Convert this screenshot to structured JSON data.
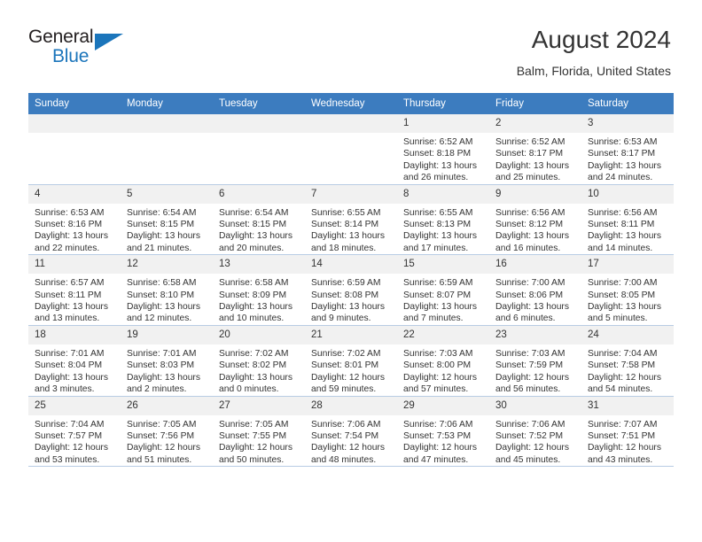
{
  "brand": {
    "general": "General",
    "blue": "Blue",
    "triangle_color": "#1b75bb"
  },
  "header": {
    "title": "August 2024",
    "location": "Balm, Florida, United States"
  },
  "theme": {
    "header_row_bg": "#3c7cbf",
    "daynum_bg": "#f1f1f1",
    "grid_border": "#b8cce4",
    "text": "#333333"
  },
  "weekday_headers": [
    "Sunday",
    "Monday",
    "Tuesday",
    "Wednesday",
    "Thursday",
    "Friday",
    "Saturday"
  ],
  "labels": {
    "sunrise_prefix": "Sunrise:",
    "sunset_prefix": "Sunset:",
    "daylight_prefix": "Daylight:"
  },
  "weeks": [
    [
      {
        "day": "",
        "empty": true
      },
      {
        "day": "",
        "empty": true
      },
      {
        "day": "",
        "empty": true
      },
      {
        "day": "",
        "empty": true
      },
      {
        "day": "1",
        "sunrise": "Sunrise: 6:52 AM",
        "sunset": "Sunset: 8:18 PM",
        "daylight": "Daylight: 13 hours and 26 minutes."
      },
      {
        "day": "2",
        "sunrise": "Sunrise: 6:52 AM",
        "sunset": "Sunset: 8:17 PM",
        "daylight": "Daylight: 13 hours and 25 minutes."
      },
      {
        "day": "3",
        "sunrise": "Sunrise: 6:53 AM",
        "sunset": "Sunset: 8:17 PM",
        "daylight": "Daylight: 13 hours and 24 minutes."
      }
    ],
    [
      {
        "day": "4",
        "sunrise": "Sunrise: 6:53 AM",
        "sunset": "Sunset: 8:16 PM",
        "daylight": "Daylight: 13 hours and 22 minutes."
      },
      {
        "day": "5",
        "sunrise": "Sunrise: 6:54 AM",
        "sunset": "Sunset: 8:15 PM",
        "daylight": "Daylight: 13 hours and 21 minutes."
      },
      {
        "day": "6",
        "sunrise": "Sunrise: 6:54 AM",
        "sunset": "Sunset: 8:15 PM",
        "daylight": "Daylight: 13 hours and 20 minutes."
      },
      {
        "day": "7",
        "sunrise": "Sunrise: 6:55 AM",
        "sunset": "Sunset: 8:14 PM",
        "daylight": "Daylight: 13 hours and 18 minutes."
      },
      {
        "day": "8",
        "sunrise": "Sunrise: 6:55 AM",
        "sunset": "Sunset: 8:13 PM",
        "daylight": "Daylight: 13 hours and 17 minutes."
      },
      {
        "day": "9",
        "sunrise": "Sunrise: 6:56 AM",
        "sunset": "Sunset: 8:12 PM",
        "daylight": "Daylight: 13 hours and 16 minutes."
      },
      {
        "day": "10",
        "sunrise": "Sunrise: 6:56 AM",
        "sunset": "Sunset: 8:11 PM",
        "daylight": "Daylight: 13 hours and 14 minutes."
      }
    ],
    [
      {
        "day": "11",
        "sunrise": "Sunrise: 6:57 AM",
        "sunset": "Sunset: 8:11 PM",
        "daylight": "Daylight: 13 hours and 13 minutes."
      },
      {
        "day": "12",
        "sunrise": "Sunrise: 6:58 AM",
        "sunset": "Sunset: 8:10 PM",
        "daylight": "Daylight: 13 hours and 12 minutes."
      },
      {
        "day": "13",
        "sunrise": "Sunrise: 6:58 AM",
        "sunset": "Sunset: 8:09 PM",
        "daylight": "Daylight: 13 hours and 10 minutes."
      },
      {
        "day": "14",
        "sunrise": "Sunrise: 6:59 AM",
        "sunset": "Sunset: 8:08 PM",
        "daylight": "Daylight: 13 hours and 9 minutes."
      },
      {
        "day": "15",
        "sunrise": "Sunrise: 6:59 AM",
        "sunset": "Sunset: 8:07 PM",
        "daylight": "Daylight: 13 hours and 7 minutes."
      },
      {
        "day": "16",
        "sunrise": "Sunrise: 7:00 AM",
        "sunset": "Sunset: 8:06 PM",
        "daylight": "Daylight: 13 hours and 6 minutes."
      },
      {
        "day": "17",
        "sunrise": "Sunrise: 7:00 AM",
        "sunset": "Sunset: 8:05 PM",
        "daylight": "Daylight: 13 hours and 5 minutes."
      }
    ],
    [
      {
        "day": "18",
        "sunrise": "Sunrise: 7:01 AM",
        "sunset": "Sunset: 8:04 PM",
        "daylight": "Daylight: 13 hours and 3 minutes."
      },
      {
        "day": "19",
        "sunrise": "Sunrise: 7:01 AM",
        "sunset": "Sunset: 8:03 PM",
        "daylight": "Daylight: 13 hours and 2 minutes."
      },
      {
        "day": "20",
        "sunrise": "Sunrise: 7:02 AM",
        "sunset": "Sunset: 8:02 PM",
        "daylight": "Daylight: 13 hours and 0 minutes."
      },
      {
        "day": "21",
        "sunrise": "Sunrise: 7:02 AM",
        "sunset": "Sunset: 8:01 PM",
        "daylight": "Daylight: 12 hours and 59 minutes."
      },
      {
        "day": "22",
        "sunrise": "Sunrise: 7:03 AM",
        "sunset": "Sunset: 8:00 PM",
        "daylight": "Daylight: 12 hours and 57 minutes."
      },
      {
        "day": "23",
        "sunrise": "Sunrise: 7:03 AM",
        "sunset": "Sunset: 7:59 PM",
        "daylight": "Daylight: 12 hours and 56 minutes."
      },
      {
        "day": "24",
        "sunrise": "Sunrise: 7:04 AM",
        "sunset": "Sunset: 7:58 PM",
        "daylight": "Daylight: 12 hours and 54 minutes."
      }
    ],
    [
      {
        "day": "25",
        "sunrise": "Sunrise: 7:04 AM",
        "sunset": "Sunset: 7:57 PM",
        "daylight": "Daylight: 12 hours and 53 minutes."
      },
      {
        "day": "26",
        "sunrise": "Sunrise: 7:05 AM",
        "sunset": "Sunset: 7:56 PM",
        "daylight": "Daylight: 12 hours and 51 minutes."
      },
      {
        "day": "27",
        "sunrise": "Sunrise: 7:05 AM",
        "sunset": "Sunset: 7:55 PM",
        "daylight": "Daylight: 12 hours and 50 minutes."
      },
      {
        "day": "28",
        "sunrise": "Sunrise: 7:06 AM",
        "sunset": "Sunset: 7:54 PM",
        "daylight": "Daylight: 12 hours and 48 minutes."
      },
      {
        "day": "29",
        "sunrise": "Sunrise: 7:06 AM",
        "sunset": "Sunset: 7:53 PM",
        "daylight": "Daylight: 12 hours and 47 minutes."
      },
      {
        "day": "30",
        "sunrise": "Sunrise: 7:06 AM",
        "sunset": "Sunset: 7:52 PM",
        "daylight": "Daylight: 12 hours and 45 minutes."
      },
      {
        "day": "31",
        "sunrise": "Sunrise: 7:07 AM",
        "sunset": "Sunset: 7:51 PM",
        "daylight": "Daylight: 12 hours and 43 minutes."
      }
    ]
  ]
}
